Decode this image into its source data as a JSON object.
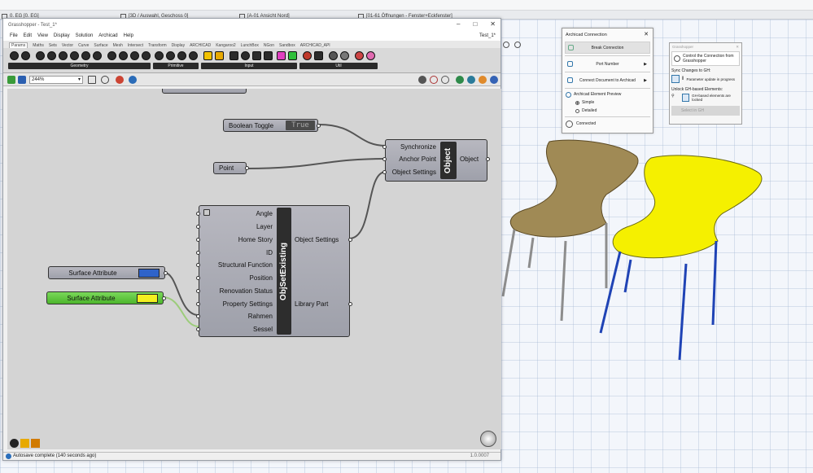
{
  "archicad": {
    "tabs": [
      {
        "label": "0. EG [0. EG]"
      },
      {
        "label": "[3D / Auswahl, Geschoss 0]"
      },
      {
        "label": "[A-01 Ansicht Nord]"
      },
      {
        "label": "[01-61 Öffnungen - Fenster+Eckfenster]"
      }
    ]
  },
  "grasshopper": {
    "window_title": "Grasshopper - Test_1*",
    "doc_name": "Test_1*",
    "menu": [
      "File",
      "Edit",
      "View",
      "Display",
      "Solution",
      "Archicad",
      "Help"
    ],
    "tabs": [
      "Params",
      "Maths",
      "Sets",
      "Vector",
      "Curve",
      "Surface",
      "Mesh",
      "Intersect",
      "Transform",
      "Display",
      "ARCHICAD",
      "Kangaroo2",
      "LunchBox",
      "NGon",
      "Sandbox",
      "ARCHICAD_API"
    ],
    "active_tab": "Params",
    "categories": [
      "Geometry",
      "Primitive",
      "Input",
      "Util"
    ],
    "zoom": "244%",
    "status": "Autosave complete (140 seconds ago)",
    "version": "1.0.0007"
  },
  "canvas": {
    "boolean_toggle": {
      "label": "Boolean Toggle",
      "value": "True"
    },
    "point": {
      "label": "Point"
    },
    "object_comp": {
      "name": "Object",
      "inputs": [
        "Synchronize",
        "Anchor Point",
        "Object Settings"
      ],
      "outputs": [
        "Object"
      ]
    },
    "objset_comp": {
      "name": "ObjSetExisting",
      "inputs": [
        "Angle",
        "Layer",
        "Home Story",
        "ID",
        "Structural Function",
        "Position",
        "Renovation Status",
        "Property Settings",
        "Rahmen",
        "Sessel"
      ],
      "outputs": [
        "Object Settings",
        "Library Part"
      ]
    },
    "surface_attr_1": {
      "label": "Surface Attribute",
      "swatch": "#2f63c9"
    },
    "surface_attr_2": {
      "label": "Surface Attribute",
      "swatch": "#f3f020",
      "fill": "#5cc83a"
    }
  },
  "connection_palette": {
    "title": "Archicad Connection",
    "break": "Break Connection",
    "port": "Port Number",
    "connect_doc": "Connect Document to Archicad",
    "preview": "Archicad Element Preview",
    "simple": "Simple",
    "detailed": "Detailed",
    "status": "Connected"
  },
  "gh_palette": {
    "title": "Grasshopper",
    "control": "Control the Connection from Grasshopper",
    "sync_heading": "Sync Changes to GH:",
    "sync_text": "Parameter update in progress",
    "unlock_heading": "Unlock GH-based Elements:",
    "unlock_text": "GH-based elements are locked",
    "select": "Select in GH"
  },
  "colors": {
    "chair_wood": "#a08a55",
    "chair_yellow": "#f5f000",
    "chair_blue_legs": "#1f43b5"
  }
}
